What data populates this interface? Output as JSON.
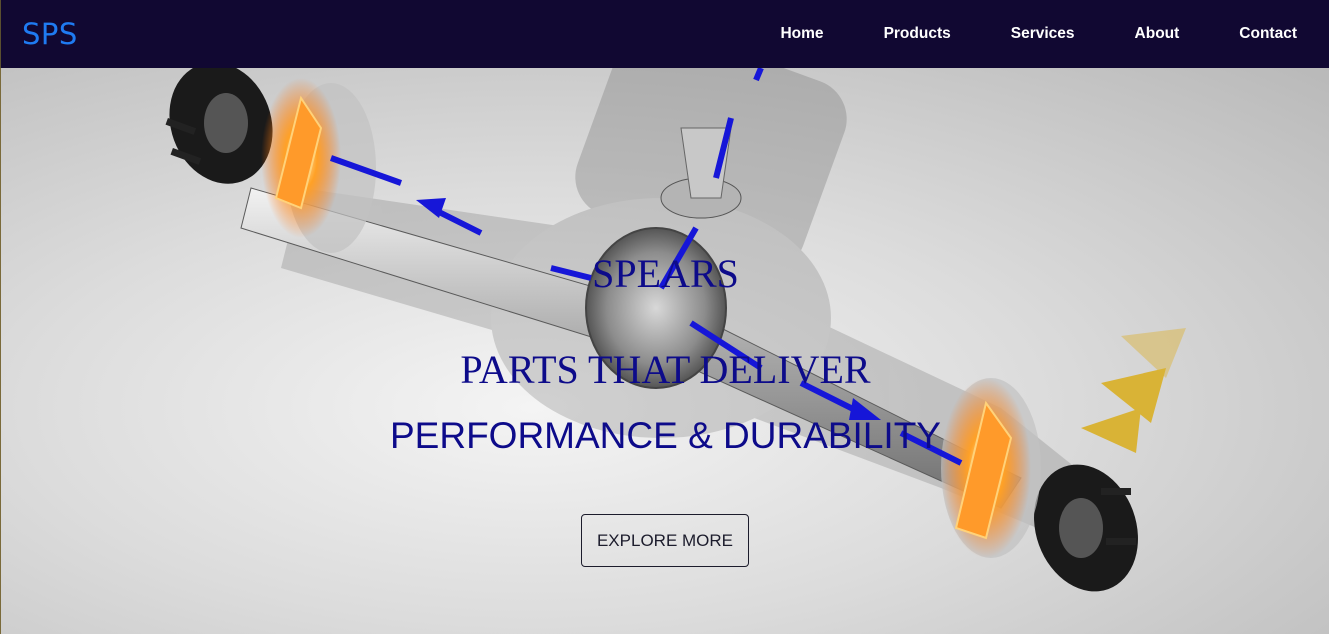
{
  "navbar": {
    "brand": "SPS",
    "links": [
      {
        "label": "Home"
      },
      {
        "label": "Products"
      },
      {
        "label": "Services"
      },
      {
        "label": "About"
      },
      {
        "label": "Contact"
      }
    ]
  },
  "hero": {
    "brand_name": "SPEARS",
    "tagline_line1": "PARTS THAT DELIVER",
    "tagline_line2": "PERFORMANCE & DURABILITY",
    "cta_label": "EXPLORE MORE",
    "image_subject": "rear-axle-differential-illustration"
  },
  "colors": {
    "navbar_bg": "#110832",
    "brand": "#1f7bf2",
    "hero_text": "#0d0b8a",
    "flow_arrow": "#1616d8",
    "glow_orange": "#ff8a1a",
    "chevron_gold": "#d9b336"
  }
}
